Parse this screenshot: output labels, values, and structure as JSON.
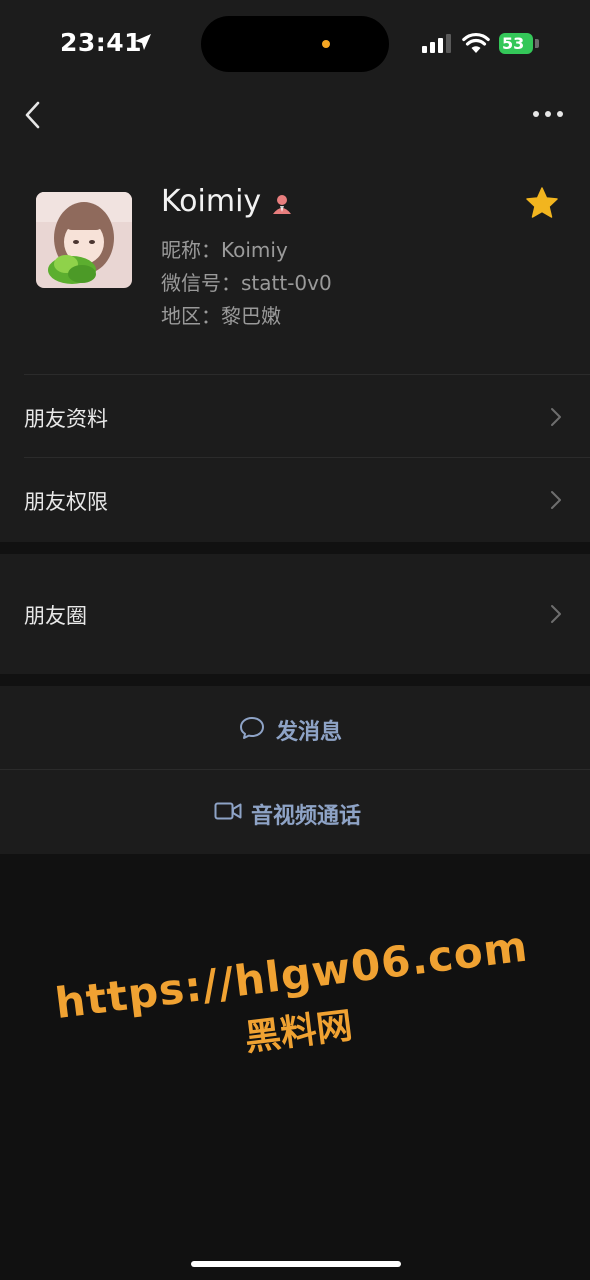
{
  "status_bar": {
    "time": "23:41",
    "battery": "53",
    "icons": [
      "location-arrow-icon",
      "signal-icon",
      "wifi-icon",
      "battery-charging-icon"
    ]
  },
  "nav": {
    "back_icon": "chevron-left-icon",
    "more_icon": "more-dots-icon"
  },
  "profile": {
    "name": "Koimiy",
    "nickname": "昵称：Koimiy",
    "wechat_id": "微信号：statt-0v0",
    "region": "地区：黎巴嫩",
    "gender_icon": "female-icon",
    "star_icon": "star-icon",
    "star_color": "#f2b51f"
  },
  "rows": [
    {
      "label": "朋友资料"
    },
    {
      "label": "朋友权限"
    },
    {
      "label": "朋友圈"
    }
  ],
  "actions": {
    "message": "发消息",
    "call": "音视频通话",
    "accent": "#8ea3c6"
  },
  "watermark": {
    "url": "https://hlgw06.com",
    "subtitle": "黑料网",
    "color": "#f0a232"
  }
}
